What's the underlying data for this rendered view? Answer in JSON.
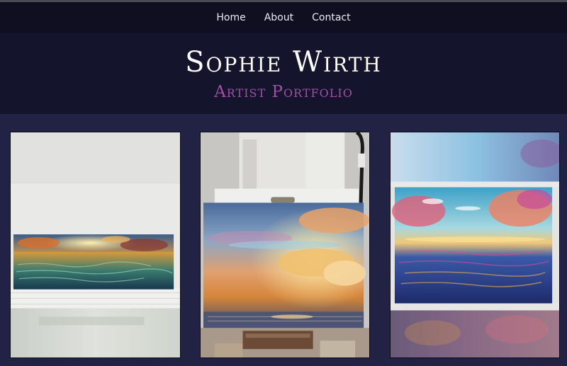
{
  "nav": {
    "items": [
      {
        "label": "Home"
      },
      {
        "label": "About"
      },
      {
        "label": "Contact"
      }
    ]
  },
  "header": {
    "title": "Sophie Wirth",
    "subtitle": "Artist Portfolio"
  },
  "gallery": {
    "items": [
      {
        "subject": "panoramic sunset seascape painting"
      },
      {
        "subject": "sunset clouds over sea painting on easel"
      },
      {
        "subject": "colorful sunset reflection seascape painting"
      }
    ]
  }
}
